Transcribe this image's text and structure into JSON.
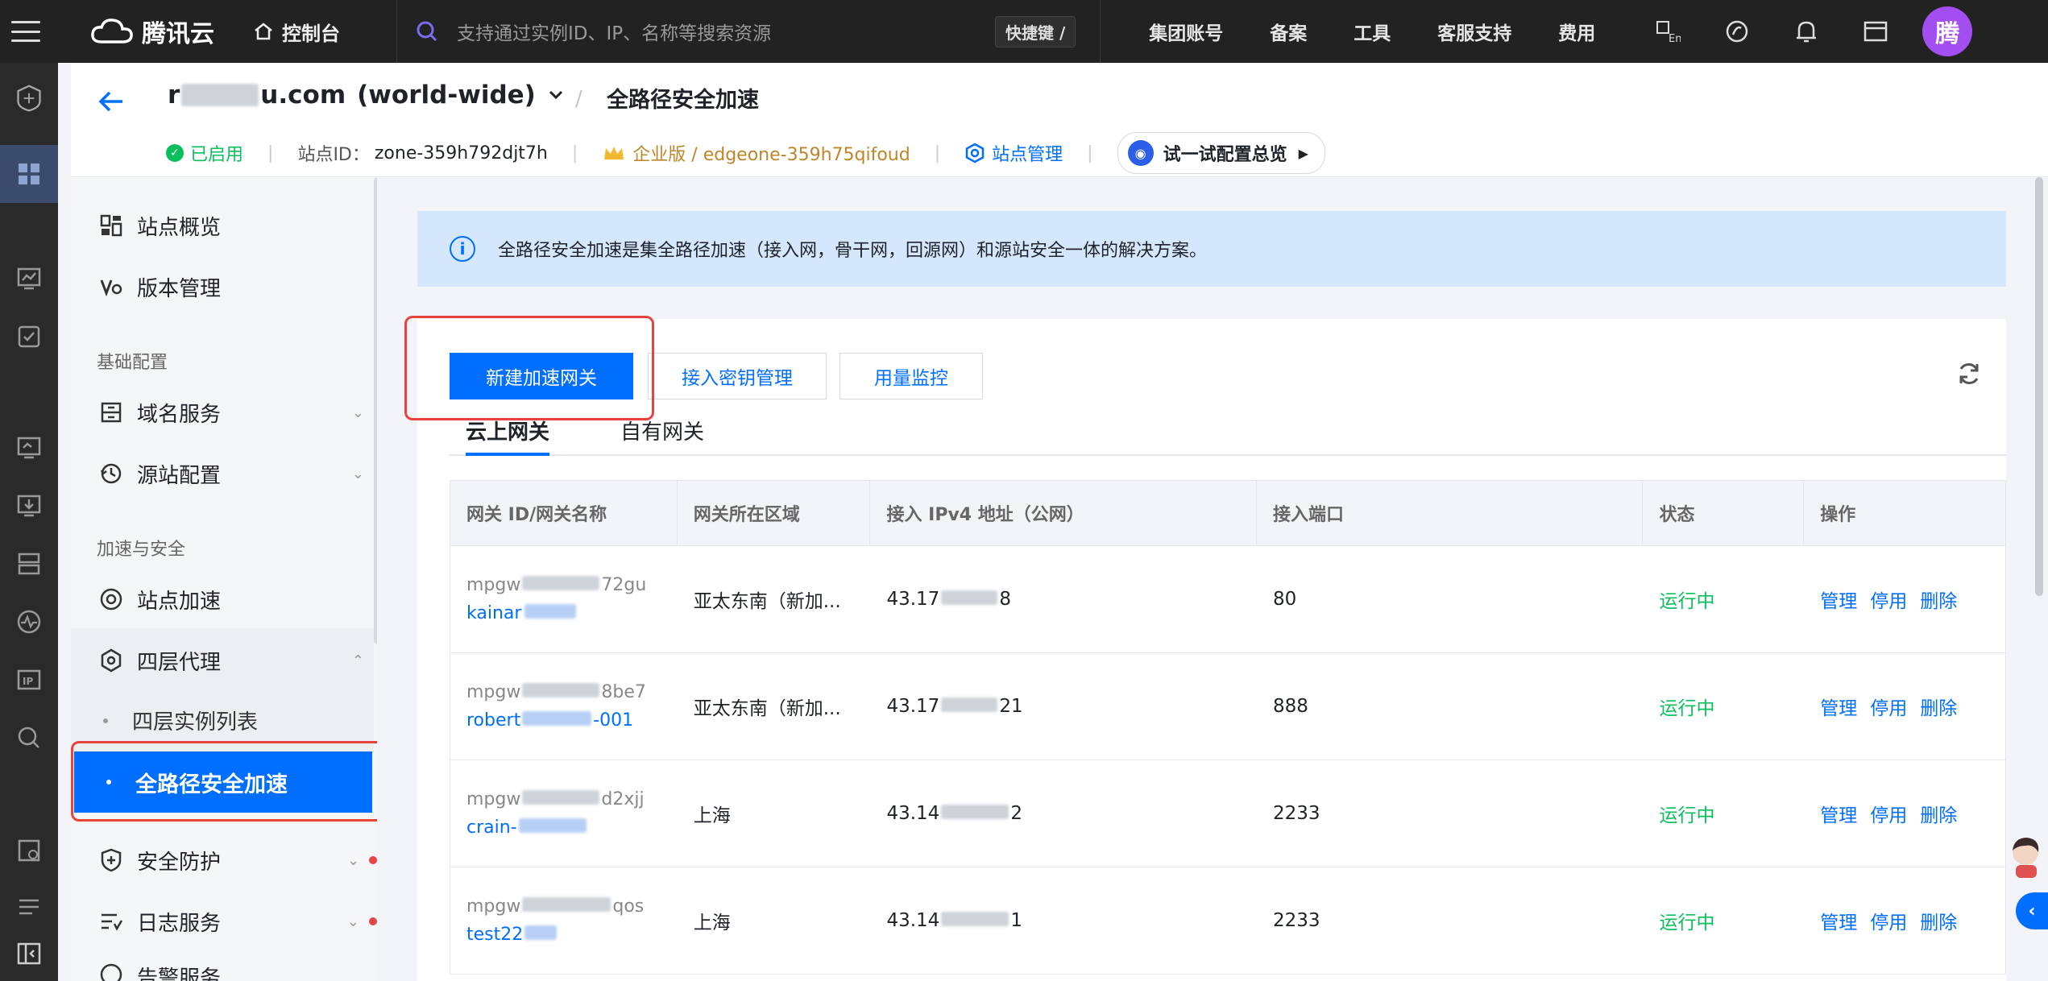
{
  "topbar": {
    "brand": "腾讯云",
    "console": "控制台",
    "search_placeholder": "支持通过实例ID、IP、名称等搜索资源",
    "shortcut": "快捷键 /",
    "links": [
      "集团账号",
      "备案",
      "工具",
      "客服支持",
      "费用"
    ],
    "avatar_initial": "腾"
  },
  "header": {
    "site_name_visible_start": "r",
    "site_name_visible_end": "u.com",
    "site_scope": "(world-wide)",
    "page_title": "全路径安全加速",
    "status": "已启用",
    "zone_label": "站点ID：",
    "zone_id": "zone-359h792djt7h",
    "plan": "企业版 / edgeone-359h75qifoud",
    "site_manage": "站点管理",
    "try_config": "试一试配置总览"
  },
  "sidebar": {
    "items_top": [
      {
        "label": "站点概览",
        "icon": "overview-icon"
      },
      {
        "label": "版本管理",
        "icon": "version-icon"
      }
    ],
    "group_basic": "基础配置",
    "items_basic": [
      {
        "label": "域名服务",
        "icon": "domain-icon"
      },
      {
        "label": "源站配置",
        "icon": "origin-icon"
      }
    ],
    "group_accel": "加速与安全",
    "item_site_accel": "站点加速",
    "item_l4_proxy": "四层代理",
    "sub_l4_list": "四层实例列表",
    "sub_active": "全路径安全加速",
    "item_security": "安全防护",
    "item_logs": "日志服务",
    "item_alarm": "告警服务"
  },
  "main": {
    "info_text": "全路径安全加速是集全路径加速（接入网，骨干网，回源网）和源站安全一体的解决方案。",
    "btn_new": "新建加速网关",
    "btn_keys": "接入密钥管理",
    "btn_usage": "用量监控",
    "tabs": [
      "云上网关",
      "自有网关"
    ],
    "columns": [
      "网关 ID/网关名称",
      "网关所在区域",
      "接入 IPv4 地址（公网）",
      "接入端口",
      "状态",
      "操作"
    ],
    "rows": [
      {
        "id_start": "mpgw",
        "id_end": "72gu",
        "name": "kainar",
        "region": "亚太东南（新加...",
        "ip_start": "43.17",
        "ip_end": "8",
        "port": "80",
        "status": "运行中"
      },
      {
        "id_start": "mpgw",
        "id_end": "8be7",
        "name": "robert",
        "name_end": "-001",
        "region": "亚太东南（新加...",
        "ip_start": "43.17",
        "ip_end": "21",
        "port": "888",
        "status": "运行中"
      },
      {
        "id_start": "mpgw",
        "id_end": "d2xjj",
        "name": "crain-",
        "region": "上海",
        "ip_start": "43.14",
        "ip_end": "2",
        "port": "2233",
        "status": "运行中"
      },
      {
        "id_start": "mpgw",
        "id_end": "qos",
        "name": "test22",
        "region": "上海",
        "ip_start": "43.14",
        "ip_end": "1",
        "port": "2233",
        "status": "运行中"
      }
    ],
    "ops": [
      "管理",
      "停用",
      "删除"
    ]
  },
  "colors": {
    "accent": "#006eff",
    "success": "#0abf5b",
    "highlight": "#e8433f"
  }
}
